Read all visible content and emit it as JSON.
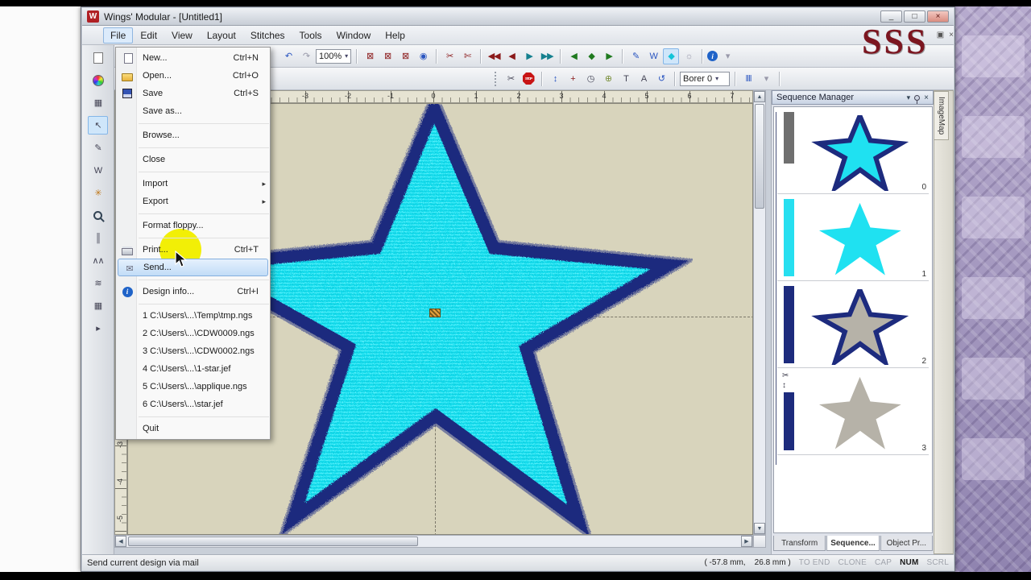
{
  "window": {
    "title": "Wings' Modular - [Untitled1]",
    "controls": {
      "minimize": "_",
      "maximize": "□",
      "close": "×"
    },
    "mdi_controls": {
      "restore": "▣",
      "close": "×"
    }
  },
  "watermark": {
    "text": "SSS"
  },
  "menubar": {
    "items": [
      "File",
      "Edit",
      "View",
      "Layout",
      "Stitches",
      "Tools",
      "Window",
      "Help"
    ]
  },
  "file_menu": {
    "submenu_arrow": "▸",
    "items": [
      {
        "label": "New...",
        "shortcut": "Ctrl+N"
      },
      {
        "label": "Open...",
        "shortcut": "Ctrl+O"
      },
      {
        "label": "Save",
        "shortcut": "Ctrl+S"
      },
      {
        "label": "Save as...",
        "shortcut": ""
      },
      {
        "label": "Browse...",
        "shortcut": ""
      },
      {
        "label": "Close",
        "shortcut": ""
      },
      {
        "label": "Import",
        "shortcut": ""
      },
      {
        "label": "Export",
        "shortcut": ""
      },
      {
        "label": "Format floppy...",
        "shortcut": ""
      },
      {
        "label": "Print...",
        "shortcut": "Ctrl+T"
      },
      {
        "label": "Send...",
        "shortcut": ""
      },
      {
        "label": "Design info...",
        "shortcut": "Ctrl+I"
      },
      {
        "label": "1 C:\\Users\\...\\Temp\\tmp.ngs",
        "shortcut": ""
      },
      {
        "label": "2 C:\\Users\\...\\CDW0009.ngs",
        "shortcut": ""
      },
      {
        "label": "3 C:\\Users\\...\\CDW0002.ngs",
        "shortcut": ""
      },
      {
        "label": "4 C:\\Users\\...\\1-star.jef",
        "shortcut": ""
      },
      {
        "label": "5 C:\\Users\\...\\applique.ngs",
        "shortcut": ""
      },
      {
        "label": "6 C:\\Users\\...\\star.jef",
        "shortcut": ""
      },
      {
        "label": "Quit",
        "shortcut": ""
      }
    ]
  },
  "toolbar_main": {
    "zoom_value": "100%",
    "dd": "▾",
    "icons": [
      {
        "name": "undo",
        "glyph": "↶"
      },
      {
        "name": "redo",
        "glyph": "↷"
      },
      {
        "name": "stitch-view-a",
        "glyph": "⊠"
      },
      {
        "name": "stitch-view-b",
        "glyph": "⊠"
      },
      {
        "name": "stitch-view-c",
        "glyph": "⊠"
      },
      {
        "name": "preview-eye",
        "glyph": "◉"
      },
      {
        "name": "trim-a",
        "glyph": "✂"
      },
      {
        "name": "trim-b",
        "glyph": "✄"
      },
      {
        "name": "nav-first",
        "glyph": "◀◀"
      },
      {
        "name": "nav-prev",
        "glyph": "◀"
      },
      {
        "name": "nav-next",
        "glyph": "▶"
      },
      {
        "name": "nav-last",
        "glyph": "▶▶"
      },
      {
        "name": "obj-prev",
        "glyph": "◀"
      },
      {
        "name": "obj-shape",
        "glyph": "◆"
      },
      {
        "name": "obj-next",
        "glyph": "▶"
      },
      {
        "name": "measure",
        "glyph": "✎"
      },
      {
        "name": "w-tool",
        "glyph": "W"
      },
      {
        "name": "shape-diamond",
        "glyph": "◆"
      },
      {
        "name": "settings-sun",
        "glyph": "☼"
      },
      {
        "name": "info",
        "glyph": "i"
      }
    ]
  },
  "toolbar_sew": {
    "icons": [
      {
        "name": "scissors",
        "glyph": "✂"
      },
      {
        "name": "stop",
        "glyph": "STOP"
      },
      {
        "name": "needle-updown",
        "glyph": "↕"
      },
      {
        "name": "origin-cross",
        "glyph": "+"
      },
      {
        "name": "clock",
        "glyph": "◷"
      },
      {
        "name": "globe",
        "glyph": "⊕"
      },
      {
        "name": "text-tool",
        "glyph": "T"
      },
      {
        "name": "letter-a",
        "glyph": "A"
      },
      {
        "name": "rotate",
        "glyph": "↺"
      }
    ],
    "borer_label": "Borer 0",
    "needlebar_glyph": "‖‖",
    "dd": "▾"
  },
  "left_toolbar": {
    "icons": [
      {
        "name": "design-browser",
        "glyph": "▦"
      },
      {
        "name": "select-object",
        "glyph": "↖"
      },
      {
        "name": "edit-pen",
        "glyph": "✎"
      },
      {
        "name": "lettering-w",
        "glyph": "W"
      },
      {
        "name": "star-shape",
        "glyph": "✳"
      },
      {
        "name": "running-stitch",
        "glyph": "║"
      },
      {
        "name": "zigzag-stitch",
        "glyph": "∧∧"
      },
      {
        "name": "satin-stitch",
        "glyph": "≋"
      },
      {
        "name": "pattern-grid",
        "glyph": "▦"
      },
      {
        "name": "collapse",
        "glyph": "▸"
      }
    ]
  },
  "rulers": {
    "horizontal": [
      "-3",
      "-2",
      "-1",
      "0",
      "1",
      "2",
      "3",
      "4",
      "5",
      "6",
      "7"
    ],
    "vertical": [
      "-3",
      "-4",
      "-5"
    ]
  },
  "sequence_manager": {
    "title": "Sequence Manager",
    "header_icons": {
      "menu": "▾",
      "close": "×"
    },
    "items": [
      {
        "index": "0"
      },
      {
        "index": "1"
      },
      {
        "index": "2"
      },
      {
        "index": "3",
        "cut_glyph": "✂",
        "needle_glyph": "↕"
      }
    ],
    "tabs": [
      {
        "label": "Transform"
      },
      {
        "label": "Sequence..."
      },
      {
        "label": "Object Pr..."
      }
    ]
  },
  "imagemap": {
    "label": "ImageMap"
  },
  "statusbar": {
    "message": "Send current design via mail",
    "coordinates": "( -57.8 mm,    26.8 mm )",
    "toggles": [
      {
        "label": "TO END"
      },
      {
        "label": "CLONE"
      },
      {
        "label": "CAP"
      },
      {
        "label": "NUM"
      },
      {
        "label": "SCRL"
      }
    ]
  },
  "colors": {
    "star_fill": "#1fe1f1",
    "star_outline": "#1d2b7e",
    "canvas": "#d8d4bc",
    "spotlight": "#f2ef06",
    "menu_highlight": "#c2ddf7"
  }
}
